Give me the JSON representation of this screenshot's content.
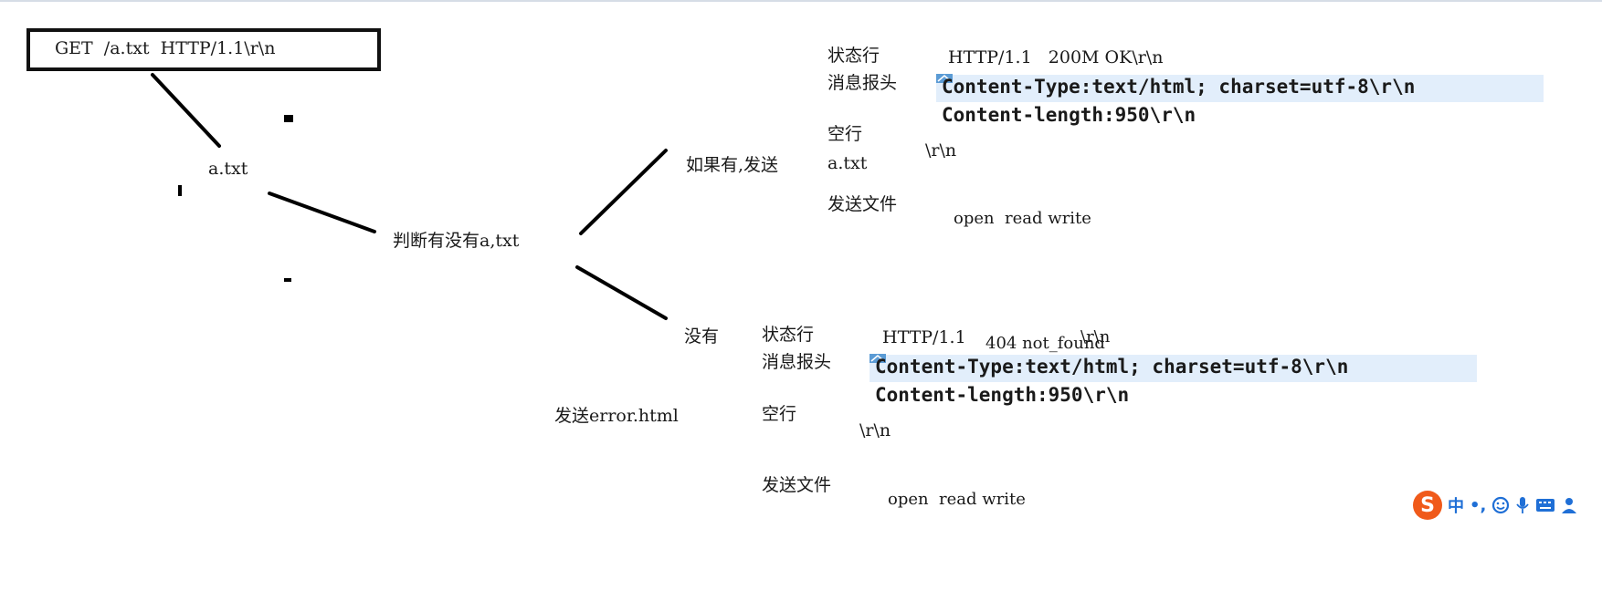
{
  "request": {
    "line": "GET  /a.txt  HTTP/1.1\\r\\n"
  },
  "file": "a.txt",
  "decision": "判断有没有a,txt",
  "yes_branch": {
    "label": "如果有,发送",
    "status_label": "状态行",
    "status_value": "HTTP/1.1   200M OK\\r\\n",
    "header_label": "消息报头",
    "header_line_1": "Content-Type:text/html; charset=utf-8\\r\\n",
    "header_line_2": "Content-length:950\\r\\n",
    "blank_label": "空行",
    "blank_value": "\\r\\n",
    "file_name": "a.txt",
    "send_label": "发送文件",
    "send_ops": "open  read write"
  },
  "no_branch": {
    "label": "没有",
    "send_error": "发送error.html",
    "status_label": "状态行",
    "status_proto": "HTTP/1.1",
    "status_code": "404 not_found",
    "status_crlf": "\\r\\n",
    "header_label": "消息报头",
    "header_line_1": "Content-Type:text/html; charset=utf-8\\r\\n",
    "header_line_2": "Content-length:950\\r\\n",
    "blank_label": "空行",
    "blank_value": "\\r\\n",
    "send_label": "发送文件",
    "send_ops": "open  read write"
  },
  "ime_toolbar": {
    "logo": "S",
    "lang": "中",
    "punct": "•,",
    "emoji_icon": "smiley-icon",
    "voice_icon": "microphone-icon",
    "keyboard_icon": "keyboard-icon",
    "user_icon": "user-icon",
    "accent": "#f05a1a",
    "icon_color": "#1f6fd6"
  }
}
